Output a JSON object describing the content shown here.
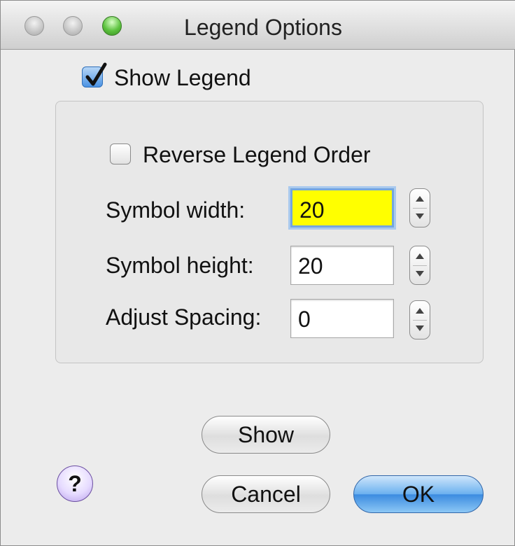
{
  "window": {
    "title": "Legend Options"
  },
  "show_legend": {
    "label": "Show Legend",
    "checked": true
  },
  "options": {
    "reverse_order": {
      "label": "Reverse Legend Order",
      "checked": false
    },
    "symbol_width": {
      "label": "Symbol width:",
      "value": "20"
    },
    "symbol_height": {
      "label": "Symbol height:",
      "value": "20"
    },
    "adjust_spacing": {
      "label": "Adjust Spacing:",
      "value": "0"
    }
  },
  "buttons": {
    "show": "Show",
    "cancel": "Cancel",
    "ok": "OK",
    "help": "?"
  },
  "colors": {
    "focused_field_bg": "#ffff00",
    "default_button": "#4a9be6",
    "focus_ring": "#74a6de"
  }
}
